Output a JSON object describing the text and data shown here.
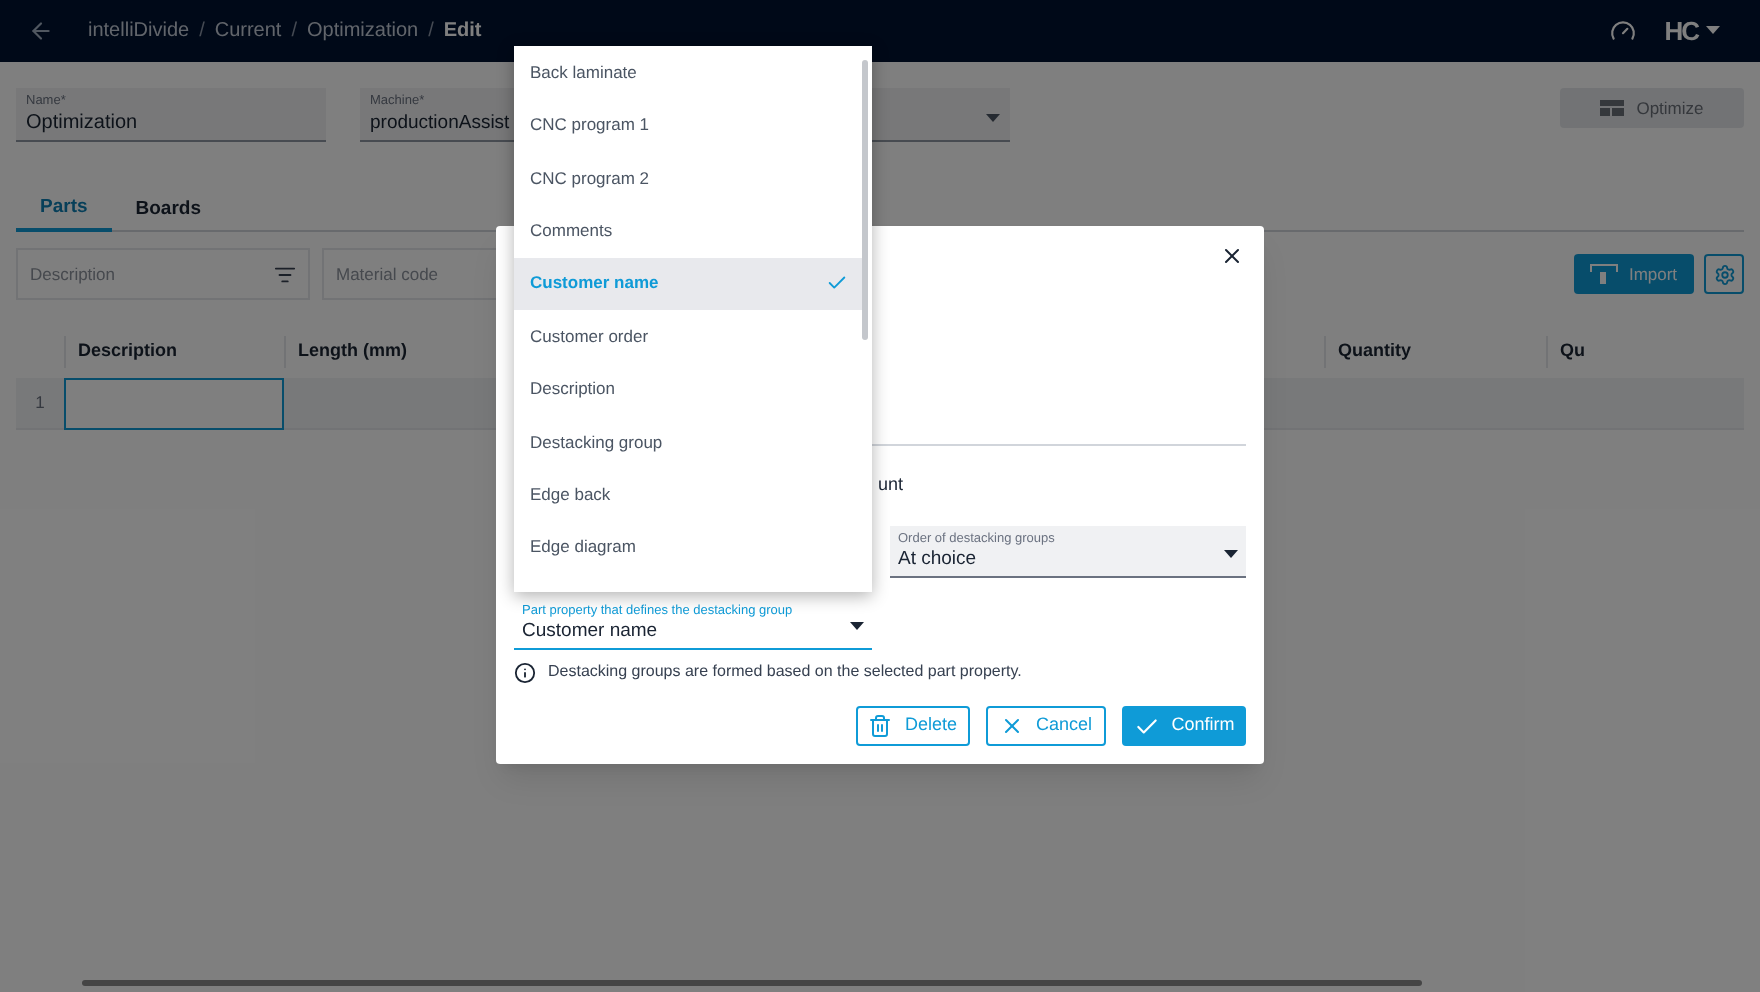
{
  "header": {
    "breadcrumb": [
      {
        "label": "intelliDivide",
        "current": false
      },
      {
        "label": "Current",
        "current": false
      },
      {
        "label": "Optimization",
        "current": false
      },
      {
        "label": "Edit",
        "current": true
      }
    ],
    "separator": "/",
    "logo": "HC"
  },
  "form": {
    "name": {
      "label": "Name*",
      "value": "Optimization"
    },
    "machine": {
      "label": "Machine*",
      "value": "productionAssist"
    },
    "optimize_button": {
      "label": "Optimize",
      "disabled": true
    }
  },
  "tabs": [
    {
      "label": "Parts",
      "selected": true
    },
    {
      "label": "Boards",
      "selected": false
    }
  ],
  "filters": [
    {
      "placeholder": "Description",
      "kind": "filter"
    },
    {
      "placeholder": "Material code",
      "kind": "plain"
    }
  ],
  "import_button": {
    "label": "Import"
  },
  "table": {
    "columns": [
      "Description",
      "Length (mm)",
      "Quantity",
      "Qu"
    ],
    "rows": [
      {
        "number": "1"
      }
    ]
  },
  "dialog": {
    "partial_text": "unt",
    "order_field": {
      "label": "Order of destacking groups",
      "value": "At choice"
    },
    "property_field": {
      "label": "Part property that defines the destacking group",
      "value": "Customer name",
      "focused": true
    },
    "info": "Destacking groups are formed based on the selected part property.",
    "buttons": [
      {
        "label": "Delete",
        "kind": "delete"
      },
      {
        "label": "Cancel",
        "kind": "cancel"
      },
      {
        "label": "Confirm",
        "kind": "confirm"
      }
    ]
  },
  "dropdown": {
    "options": [
      {
        "label": "Back laminate",
        "selected": false
      },
      {
        "label": "CNC program 1",
        "selected": false
      },
      {
        "label": "CNC program 2",
        "selected": false
      },
      {
        "label": "Comments",
        "selected": false
      },
      {
        "label": "Customer name",
        "selected": true
      },
      {
        "label": "Customer order",
        "selected": false
      },
      {
        "label": "Description",
        "selected": false
      },
      {
        "label": "Destacking group",
        "selected": false
      },
      {
        "label": "Edge back",
        "selected": false
      },
      {
        "label": "Edge diagram",
        "selected": false
      }
    ]
  }
}
